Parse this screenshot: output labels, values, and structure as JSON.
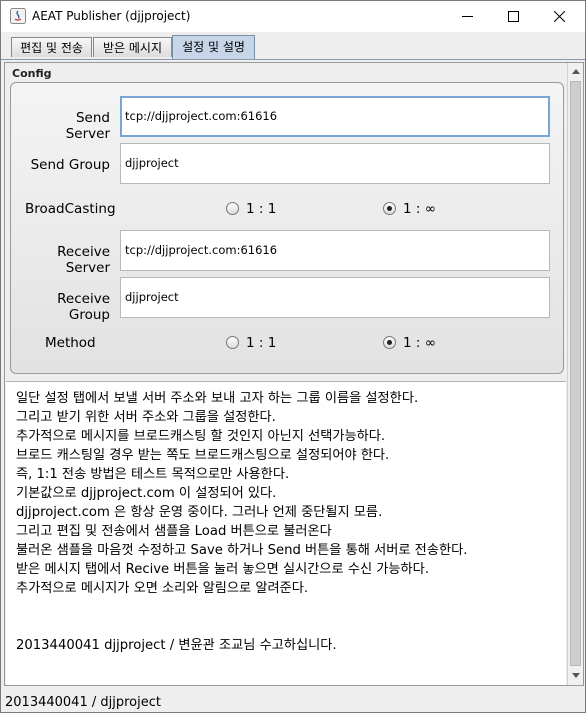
{
  "window": {
    "title": "AEAT Publisher (djjproject)"
  },
  "tabs": [
    {
      "label": "편집 및 전송",
      "selected": false
    },
    {
      "label": "받은 메시지",
      "selected": false
    },
    {
      "label": "설정 및 설명",
      "selected": true
    }
  ],
  "config": {
    "section_label": "Config",
    "send_server": {
      "label": "Send Server",
      "value": "tcp://djjproject.com:61616"
    },
    "send_group": {
      "label": "Send Group",
      "value": "djjproject"
    },
    "broadcasting": {
      "label": "BroadCasting",
      "option1": "1 : 1",
      "option2": "1 : ∞",
      "selected": "1 : ∞"
    },
    "receive_server": {
      "label": "Receive Server",
      "value": "tcp://djjproject.com:61616"
    },
    "receive_group": {
      "label": "Receive Group",
      "value": "djjproject"
    },
    "method": {
      "label": "Method",
      "option1": "1 : 1",
      "option2": "1 : ∞",
      "selected": "1 : ∞"
    }
  },
  "description": {
    "lines": [
      "일단 설정 탭에서 보낼 서버 주소와 보내 고자 하는 그룹 이름을 설정한다.",
      "그리고 받기 위한 서버 주소와 그룹을 설정한다.",
      "추가적으로 메시지를 브로드캐스팅 할 것인지 아닌지 선택가능하다.",
      "브로드 캐스팅일 경우 받는 쪽도 브로드캐스팅으로 설정되어야 한다.",
      "즉, 1:1 전송 방법은 테스트 목적으로만 사용한다.",
      "기본값으로 djjproject.com 이 설정되어 있다.",
      "djjproject.com 은 항상 운영 중이다. 그러나 언제 중단될지 모름.",
      "그리고 편집 및 전송에서 샘플을 Load 버튼으로 불러온다",
      "불러온 샘플을 마음껏 수정하고 Save 하거나 Send 버튼을 통해 서버로 전송한다.",
      "받은 메시지 탭에서 Recive 버튼을 눌러 놓으면 실시간으로 수신 가능하다.",
      "추가적으로 메시지가 오면 소리와 알림으로 알려준다."
    ],
    "footer_line": "2013440041 djjproject / 변윤관 조교님 수고하십니다."
  },
  "status_bar": {
    "text": "2013440041 / djjproject"
  }
}
